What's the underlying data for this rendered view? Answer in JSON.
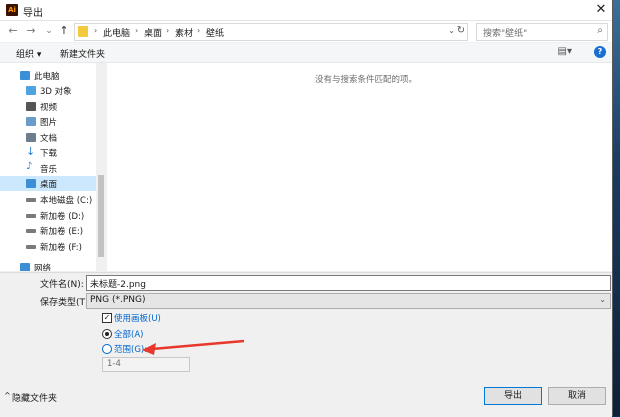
{
  "window": {
    "title": "导出",
    "app_badge": "Ai",
    "close_glyph": "✕"
  },
  "nav": {
    "back": "←",
    "forward": "→",
    "dropdown": "⌄",
    "up": "↑"
  },
  "breadcrumb": [
    "此电脑",
    "桌面",
    "素材",
    "壁纸"
  ],
  "search": {
    "placeholder": "搜索\"壁纸\""
  },
  "toolbar": {
    "organize": "组织 ▾",
    "new_folder": "新建文件夹"
  },
  "sidebar": {
    "items": [
      {
        "label": "此电脑",
        "icon": "computer-icon",
        "color": "#3a8fd6"
      },
      {
        "label": "3D 对象",
        "icon": "cube-icon",
        "color": "#4fa3e0"
      },
      {
        "label": "视频",
        "icon": "video-icon",
        "color": "#555555"
      },
      {
        "label": "图片",
        "icon": "pictures-icon",
        "color": "#6a9cc9"
      },
      {
        "label": "文档",
        "icon": "documents-icon",
        "color": "#6d7f8f"
      },
      {
        "label": "下载",
        "icon": "download-icon",
        "color": "#2f7fd0"
      },
      {
        "label": "音乐",
        "icon": "music-icon",
        "color": "#2f7fd0"
      },
      {
        "label": "桌面",
        "icon": "desktop-icon",
        "color": "#3a8fd6"
      },
      {
        "label": "本地磁盘 (C:)",
        "icon": "drive-icon",
        "color": "#7a7a7a"
      },
      {
        "label": "新加卷 (D:)",
        "icon": "drive-icon",
        "color": "#7a7a7a"
      },
      {
        "label": "新加卷 (E:)",
        "icon": "drive-icon",
        "color": "#7a7a7a"
      },
      {
        "label": "新加卷 (F:)",
        "icon": "drive-icon",
        "color": "#7a7a7a"
      },
      {
        "label": "网络",
        "icon": "network-icon",
        "color": "#3a8fd6"
      }
    ],
    "selected": "桌面"
  },
  "content": {
    "empty_message": "没有与搜索条件匹配的项。"
  },
  "form": {
    "filename_label": "文件名(N):",
    "filename_value": "未标题-2.png",
    "filetype_label": "保存类型(T):",
    "filetype_value": "PNG (*.PNG)",
    "use_artboards": "使用画板(U)",
    "all_label": "全部(A)",
    "range_label": "范围(G):",
    "range_value": "1-4",
    "hide_folders": "隐藏文件夹",
    "export_button": "导出",
    "cancel_button": "取消"
  },
  "colors": {
    "accent": "#0078d7",
    "selected_bg": "#cce8ff",
    "link_blue": "#0066cc",
    "annotation_arrow": "#e8372d"
  }
}
